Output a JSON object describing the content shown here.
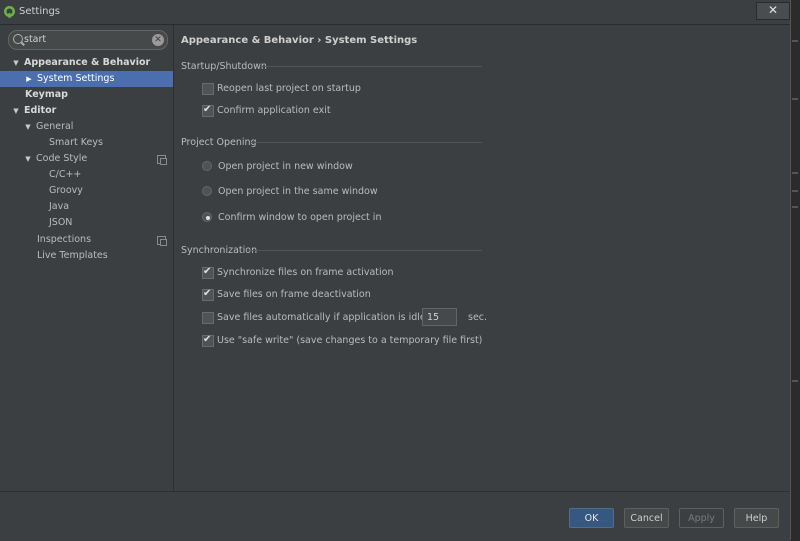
{
  "window": {
    "title": "Settings",
    "close_label": "✕"
  },
  "search": {
    "value": "start",
    "placeholder": ""
  },
  "tree": {
    "appearance": "Appearance & Behavior",
    "system_settings": "System Settings",
    "keymap": "Keymap",
    "editor": "Editor",
    "general": "General",
    "smart_keys": "Smart Keys",
    "code_style": "Code Style",
    "cpp": "C/C++",
    "groovy": "Groovy",
    "java": "Java",
    "json": "JSON",
    "inspections": "Inspections",
    "live_templates": "Live Templates"
  },
  "breadcrumb": "Appearance & Behavior › System Settings",
  "startup": {
    "title": "Startup/Shutdown",
    "reopen_label": "Reopen last project on startup",
    "reopen_checked": false,
    "confirm_exit_label": "Confirm application exit",
    "confirm_exit_checked": true
  },
  "project_opening": {
    "title": "Project Opening",
    "options": [
      "Open project in new window",
      "Open project in the same window",
      "Confirm window to open project in"
    ],
    "selected": 2
  },
  "sync": {
    "title": "Synchronization",
    "sync_frame_label": "Synchronize files on frame activation",
    "sync_frame_checked": true,
    "save_deactivation_label": "Save files on frame deactivation",
    "save_deactivation_checked": true,
    "save_idle_label": "Save files automatically if application is idle for",
    "save_idle_checked": false,
    "idle_value": "15",
    "idle_unit": "sec.",
    "safe_write_label": "Use \"safe write\" (save changes to a temporary file first)",
    "safe_write_checked": true
  },
  "buttons": {
    "ok": "OK",
    "cancel": "Cancel",
    "apply": "Apply",
    "help": "Help"
  },
  "colors": {
    "selection": "#4b6eaf",
    "primary_button": "#365880",
    "background": "#3c3f41"
  }
}
